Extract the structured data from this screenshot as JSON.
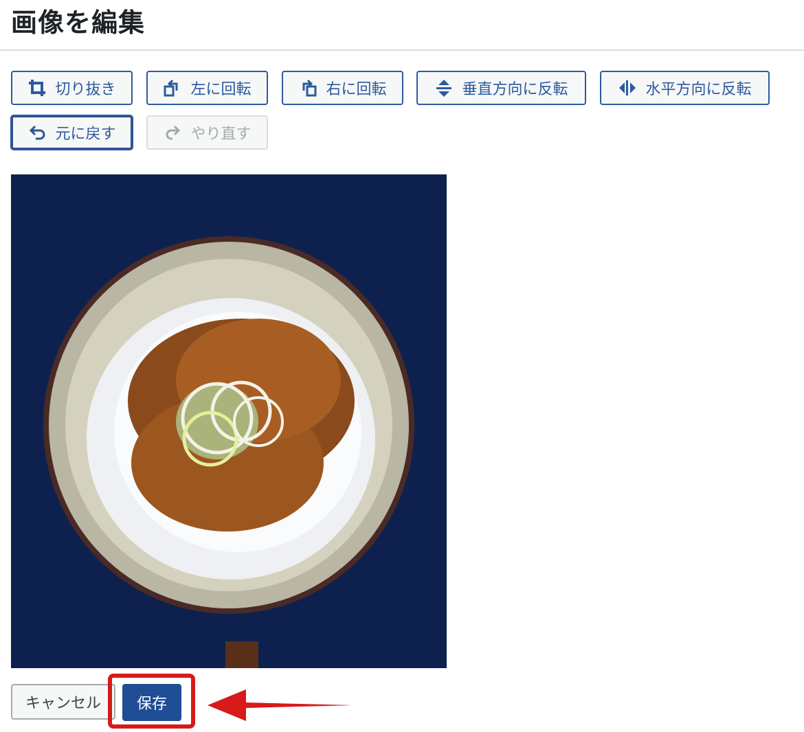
{
  "page": {
    "title": "画像を編集"
  },
  "toolbar": {
    "crop_label": "切り抜き",
    "rotate_left_label": "左に回転",
    "rotate_right_label": "右に回転",
    "flip_vertical_label": "垂直方向に反転",
    "flip_horizontal_label": "水平方向に反転",
    "undo_label": "元に戻す",
    "redo_label": "やり直す"
  },
  "icons": {
    "crop": "crop-icon",
    "rotate_left": "rotate-left-icon",
    "rotate_right": "rotate-right-icon",
    "flip_vertical": "flip-vertical-icon",
    "flip_horizontal": "flip-horizontal-icon",
    "undo": "undo-icon",
    "redo": "redo-icon"
  },
  "actions": {
    "cancel_label": "キャンセル",
    "save_label": "保存"
  },
  "colors": {
    "accent": "#2c5aa0",
    "primary_button": "#1f4d96",
    "highlight": "#d71a1a",
    "image_background": "#0c1e48"
  }
}
